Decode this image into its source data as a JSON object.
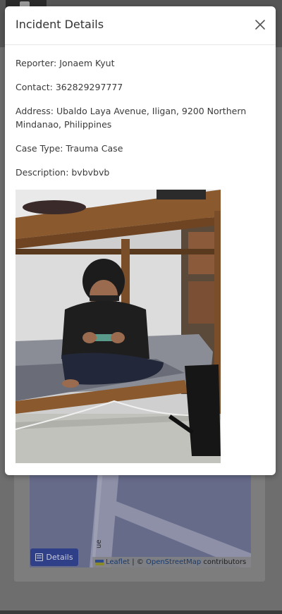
{
  "modal": {
    "title": "Incident Details",
    "fields": {
      "reporter": "Reporter: Jonaem Kyut",
      "contact": "Contact: 362829297777",
      "address": "Address: Ubaldo Laya Avenue, Iligan, 9200 Northern Mindanao, Philippines",
      "case_type": "Case Type: Trauma Case",
      "description": "Description: bvbvbvb"
    },
    "close_icon": "close-icon",
    "photo_alt": "Incident photo"
  },
  "background": {
    "details_button": "Details",
    "road_label": "ue",
    "attribution": {
      "leaflet": "Leaflet",
      "separator": " | © ",
      "osm": "OpenStreetMap",
      "contributors": " contributors"
    }
  },
  "colors": {
    "details_button_bg": "#2f3f88",
    "map_bg": "#676b8a",
    "overlay": "#6e6e6e"
  }
}
